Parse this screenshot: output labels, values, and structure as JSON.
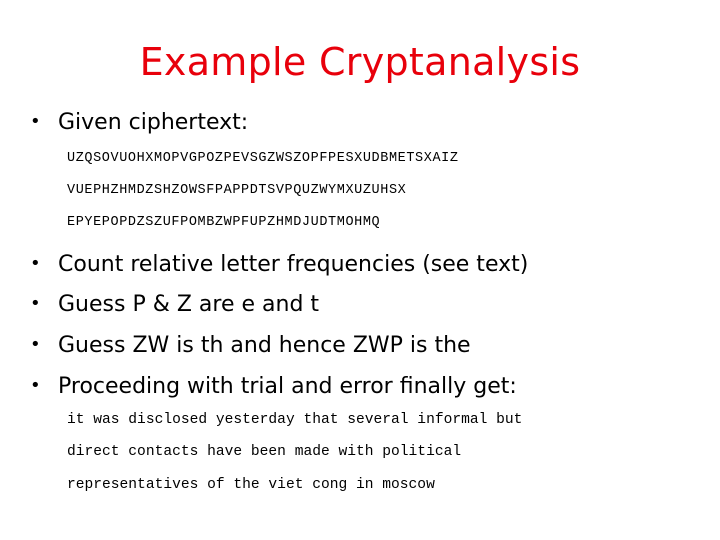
{
  "slide": {
    "title": "Example Cryptanalysis",
    "title_color": "#e8000b",
    "bullets": [
      {
        "marker": "•",
        "text": "Given ciphertext:"
      },
      {
        "marker": "•",
        "text": "Count relative letter frequencies (see text)"
      },
      {
        "marker": "•",
        "text": "Guess P & Z are e and t"
      },
      {
        "marker": "•",
        "text": "Guess ZW is th and hence ZWP is the"
      },
      {
        "marker": "•",
        "text": "Proceeding with trial and error finally get:"
      }
    ],
    "ciphertext": [
      "UZQSOVUOHXMOPVGPOZPEVSGZWSZOPFPESXUDBMETSXAIZ",
      "VUEPHZHMDZSHZOWSFPAPPDTSVPQUZWYMXUZUHSX",
      "EPYEPOPDZSZUFPOMBZWPFUPZHMDJUDTMOHMQ"
    ],
    "plaintext": [
      "it was disclosed yesterday that several informal but",
      "direct contacts have been made with political",
      "representatives of the viet cong in moscow"
    ]
  }
}
